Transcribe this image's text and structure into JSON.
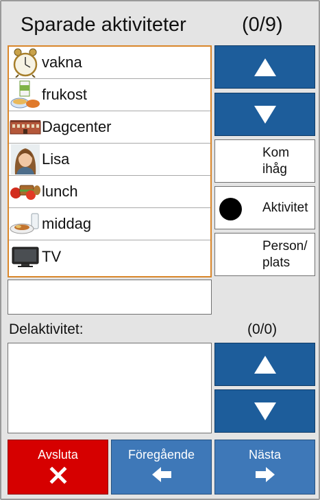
{
  "header": {
    "title": "Sparade aktiviteter",
    "count": "(0/9)"
  },
  "activities": [
    {
      "label": "vakna",
      "icon": "alarm-clock-icon"
    },
    {
      "label": "frukost",
      "icon": "breakfast-icon"
    },
    {
      "label": "Dagcenter",
      "icon": "building-icon"
    },
    {
      "label": "Lisa",
      "icon": "person-photo-icon"
    },
    {
      "label": "lunch",
      "icon": "lunch-icon"
    },
    {
      "label": "middag",
      "icon": "dinner-icon"
    },
    {
      "label": "TV",
      "icon": "tv-icon"
    }
  ],
  "side_options": {
    "kom_ihag_line1": "Kom",
    "kom_ihag_line2": "ihåg",
    "aktivitet": "Aktivitet",
    "person_line1": "Person/",
    "person_line2": "plats",
    "selected": "Aktivitet"
  },
  "sub": {
    "label": "Delaktivitet:",
    "count": "(0/0)"
  },
  "footer": {
    "quit_label": "Avsluta",
    "prev_label": "Föregående",
    "next_label": "Nästa"
  },
  "colors": {
    "nav_blue": "#1d5d9b",
    "footer_blue": "#3e78b8",
    "quit_red": "#d60000",
    "list_border": "#d9862a"
  }
}
